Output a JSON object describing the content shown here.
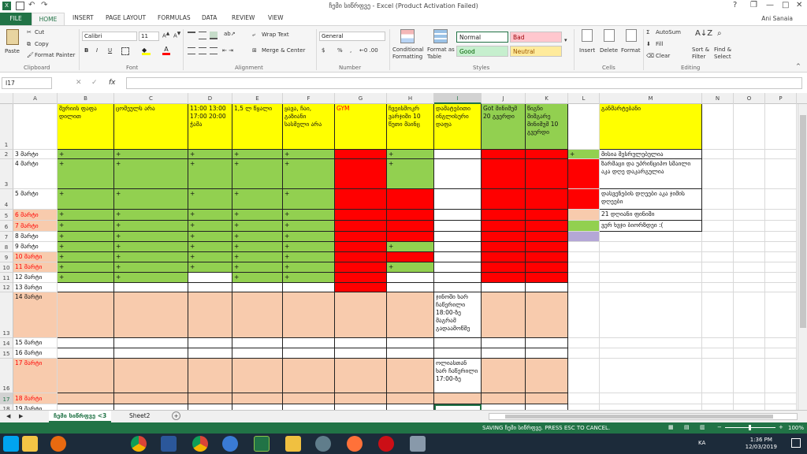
{
  "titlebar": {
    "title": "ჩემი სიწრფვე - Excel (Product Activation Failed)",
    "help": "?",
    "restore": "❐",
    "minimize": "—",
    "maximize": "□",
    "close": "✕"
  },
  "tabs": [
    "FILE",
    "HOME",
    "INSERT",
    "PAGE LAYOUT",
    "FORMULAS",
    "DATA",
    "REVIEW",
    "VIEW"
  ],
  "user": "Ani Sanaia",
  "ribbon": {
    "clipboard": {
      "paste": "Paste",
      "cut": "Cut",
      "copy": "Copy",
      "format_painter": "Format Painter",
      "label": "Clipboard"
    },
    "font": {
      "name": "Calibri",
      "size": "11",
      "bold": "B",
      "italic": "I",
      "underline": "U",
      "label": "Font"
    },
    "alignment": {
      "wrap": "Wrap Text",
      "merge": "Merge & Center",
      "label": "Alignment"
    },
    "number": {
      "format": "General",
      "currency": "$",
      "percent": "%",
      "comma": ",",
      "label": "Number"
    },
    "styles": {
      "conditional": "Conditional Formatting",
      "format_table": "Format as Table",
      "normal": "Normal",
      "bad": "Bad",
      "good": "Good",
      "neutral": "Neutral",
      "label": "Styles"
    },
    "cells": {
      "insert": "Insert",
      "delete": "Delete",
      "format": "Format",
      "label": "Cells"
    },
    "editing": {
      "autosum": "AutoSum",
      "fill": "Fill",
      "clear": "Clear",
      "sort": "Sort & Filter",
      "find": "Find & Select",
      "label": "Editing"
    }
  },
  "formula_bar": {
    "namebox": "I17",
    "fx": "fx",
    "cancel": "✕",
    "enter": "✓",
    "value": ""
  },
  "columns": [
    "A",
    "B",
    "C",
    "D",
    "E",
    "F",
    "G",
    "H",
    "I",
    "J",
    "K",
    "L",
    "M",
    "N",
    "O",
    "P"
  ],
  "selected_col": "I",
  "headers": {
    "B": "შვრიის ფაფა დილით",
    "C": "ცომეულს არა",
    "D": "11:00 13:00 17:00 20:00 ჭამა",
    "E": "1,5 ლ წყალი",
    "F": "ყავა, ჩაი, გაზიანი სასმელი არა",
    "G": "GYM",
    "H": "ჩვეისმოკრ ვარჯიში 10 წუთი მაინც",
    "I": "დამატებითი ინგლისური დაფა",
    "J": "Got მინიმუმ 20 გვერდი",
    "K": "წიგნი შიშგარე მინიმუმ 10 გვერდი",
    "M": "განმარტებანი"
  },
  "rows": [
    {
      "n": "2",
      "a": "3 მარტი",
      "plus": "+"
    },
    {
      "n": "3",
      "a": "4 მარტი",
      "plus": "+"
    },
    {
      "n": "4",
      "a": "5 მარტი",
      "plus": "+"
    },
    {
      "n": "5",
      "a": "6 მარტი",
      "plus": "+"
    },
    {
      "n": "6",
      "a": "7 მარტი",
      "plus": "+"
    },
    {
      "n": "7",
      "a": "8 მარტი",
      "plus": "+"
    },
    {
      "n": "8",
      "a": "9 მარტი",
      "plus": "+"
    },
    {
      "n": "9",
      "a": "10 მარტი",
      "plus": "+"
    },
    {
      "n": "10",
      "a": "11 მარტი",
      "plus": "+"
    },
    {
      "n": "11",
      "a": "12 მარტი",
      "plus": "+"
    },
    {
      "n": "12",
      "a": "13 მარტი"
    },
    {
      "n": "13",
      "a": "14 მარტი"
    },
    {
      "n": "14",
      "a": "15 მარტი"
    },
    {
      "n": "15",
      "a": "16 მარტი"
    },
    {
      "n": "16",
      "a": "17 მარტი"
    },
    {
      "n": "17",
      "a": "18 მარტი"
    },
    {
      "n": "18",
      "a": "19 მარტი"
    }
  ],
  "notes": {
    "i13": "ჯინოში ხარ ჩაწერილი 18:00-ზე მაგრამ გადაამოწმე",
    "i16": "ოლიასთან ხარ ჩაწერილი 17:00-ზე"
  },
  "legend": [
    "მისია შესრულებულია",
    "ზარმაცი და უპრინციპო სმაილი აკა დღე დაკარგულია",
    "დასვენების დღეები აკა ჯიმის დღეები",
    "21 დღიანი ფინიში",
    "ვერ ხვჯი ბიორზდეი :("
  ],
  "colors": {
    "green": "#92d050",
    "red": "#ff0000",
    "peach": "#f8cbad",
    "yellow": "#ffff00",
    "purple": "#b4a7d6",
    "accent": "#217346"
  },
  "sheets": [
    "ჩემი სიწრფვე <3",
    "Sheet2"
  ],
  "add_sheet": "+",
  "status": {
    "text": "SAVING ჩემი სიწრფვე. PRESS ESC TO CANCEL.",
    "zoom": "100%"
  },
  "taskbar": {
    "lang": "KA",
    "time": "1:36 PM",
    "date": "12/03/2019"
  }
}
